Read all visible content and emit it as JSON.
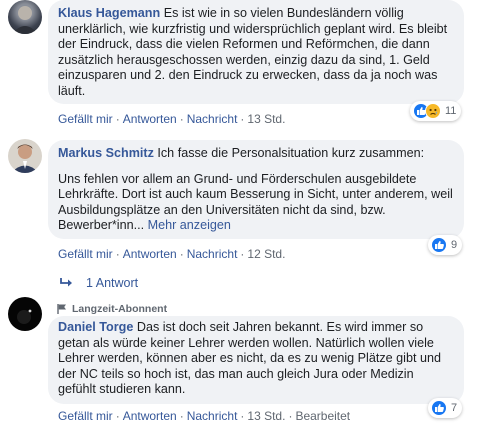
{
  "comments": [
    {
      "author": "Klaus Hagemann",
      "text": "Es ist wie in so vielen Bundesländern völlig unerklärlich, wie kurzfristig und widersprüchlich geplant wird. Es bleibt der Eindruck, dass die vielen Reformen und Reförmchen, die dann zusätzlich herausgeschossen werden, einzig dazu da sind, 1. Geld einzusparen und 2. den Eindruck zu erwecken, dass da ja noch was läuft.",
      "actions": {
        "like": "Gefällt mir",
        "reply": "Antworten",
        "message": "Nachricht",
        "time": "13 Std."
      },
      "reactions": {
        "icons": [
          "like-icon",
          "sad-icon"
        ],
        "count": "11"
      }
    },
    {
      "author": "Markus Schmitz",
      "text_line1": "Ich fasse die Personalsituation kurz zusammen:",
      "text_para": "Uns fehlen vor allem an Grund- und Förderschulen ausgebildete Lehrkräfte. Dort ist auch kaum Besserung in Sicht, unter anderem, weil Ausbildungsplätze an den Universitäten nicht da sind, bzw. Bewerber*inn...",
      "more": "Mehr anzeigen",
      "actions": {
        "like": "Gefällt mir",
        "reply": "Antworten",
        "message": "Nachricht",
        "time": "12 Std."
      },
      "reactions": {
        "icons": [
          "like-icon"
        ],
        "count": "9"
      }
    },
    {
      "badge": "Langzeit-Abonnent",
      "author": "Daniel Torge",
      "text": "Das ist doch seit Jahren bekannt. Es wird immer so getan als würde keiner Lehrer werden wollen. Natürlich wollen viele Lehrer werden, können aber es nicht, da es zu wenig Plätze gibt und der NC teils so hoch ist, das man auch gleich Jura oder Medizin gefühlt studieren kann.",
      "actions": {
        "like": "Gefällt mir",
        "reply": "Antworten",
        "message": "Nachricht",
        "time": "13 Std.",
        "edited": "Bearbeitet"
      },
      "reactions": {
        "icons": [
          "like-icon"
        ],
        "count": "7"
      }
    }
  ],
  "replies": {
    "label": "1 Antwort"
  },
  "colors": {
    "link": "#365899",
    "bubble": "#f0f2f5",
    "meta": "#606770",
    "like": "#1877f2",
    "sad": "#f7b928"
  }
}
